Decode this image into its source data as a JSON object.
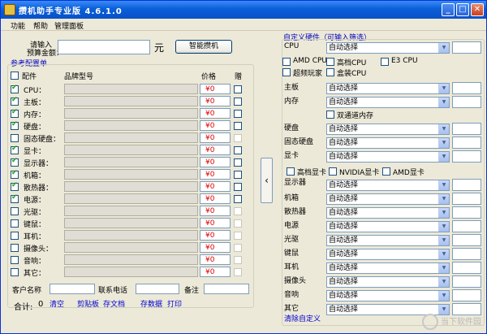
{
  "window": {
    "title": "攒机助手专业版 4.6.1.0"
  },
  "menu": [
    "功能",
    "帮助",
    "管理面板"
  ],
  "budget": {
    "label1": "请输入",
    "label2": "预算金额：",
    "value": "",
    "unit": "元",
    "button": "智能攒机"
  },
  "ref": {
    "title": "参考配置单",
    "headers": {
      "part": "配件",
      "brand": "品牌型号",
      "price": "价格",
      "gift": "赠"
    },
    "rows": [
      {
        "label": "CPU：",
        "checked": true,
        "price": "¥0",
        "gift_enabled": true
      },
      {
        "label": "主板：",
        "checked": true,
        "price": "¥0",
        "gift_enabled": true
      },
      {
        "label": "内存：",
        "checked": true,
        "price": "¥0",
        "gift_enabled": true
      },
      {
        "label": "硬盘：",
        "checked": true,
        "price": "¥0",
        "gift_enabled": true
      },
      {
        "label": "固态硬盘：",
        "checked": false,
        "price": "¥0",
        "gift_enabled": false
      },
      {
        "label": "显卡：",
        "checked": true,
        "price": "¥0",
        "gift_enabled": true
      },
      {
        "label": "显示器：",
        "checked": true,
        "price": "¥0",
        "gift_enabled": true
      },
      {
        "label": "机箱：",
        "checked": true,
        "price": "¥0",
        "gift_enabled": true
      },
      {
        "label": "散热器：",
        "checked": true,
        "price": "¥0",
        "gift_enabled": true
      },
      {
        "label": "电源：",
        "checked": true,
        "price": "¥0",
        "gift_enabled": true
      },
      {
        "label": "光驱：",
        "checked": false,
        "price": "¥0",
        "gift_enabled": false
      },
      {
        "label": "键鼠：",
        "checked": false,
        "price": "¥0",
        "gift_enabled": false
      },
      {
        "label": "耳机：",
        "checked": false,
        "price": "¥0",
        "gift_enabled": false
      },
      {
        "label": "摄像头：",
        "checked": false,
        "price": "¥0",
        "gift_enabled": false
      },
      {
        "label": "音响：",
        "checked": false,
        "price": "¥0",
        "gift_enabled": false
      },
      {
        "label": "其它：",
        "checked": false,
        "price": "¥0",
        "gift_enabled": false
      }
    ]
  },
  "customer": {
    "name_label": "客户名称",
    "phone_label": "联系电话",
    "note_label": "备注"
  },
  "total": {
    "label": "合计:",
    "value": "0"
  },
  "actions": [
    "清空",
    "剪贴板",
    "存文档",
    "存数据",
    "打印"
  ],
  "right": {
    "title": "自定义硬件（可输入筛选）",
    "select_value": "自动选择",
    "cpu_label": "CPU",
    "cpu_opts": [
      {
        "label": "AMD CPU"
      },
      {
        "label": "高档CPU"
      },
      {
        "label": "E3 CPU"
      },
      {
        "label": "超频玩家"
      },
      {
        "label": "盒装CPU"
      }
    ],
    "mb_label": "主板",
    "mem_label": "内存",
    "dual_channel": "双通道内存",
    "hdd_label": "硬盘",
    "ssd_label": "固态硬盘",
    "gpu_label": "显卡",
    "gpu_opts": [
      {
        "label": "高档显卡"
      },
      {
        "label": "NVIDIA显卡"
      },
      {
        "label": "AMD显卡"
      }
    ],
    "rows": [
      "显示器",
      "机箱",
      "散热器",
      "电源",
      "光驱",
      "键鼠",
      "耳机",
      "摄像头",
      "音响",
      "其它"
    ],
    "clear": "清除自定义"
  },
  "watermark": {
    "line1": "当下软件园",
    "line2": "www.downxia.com"
  }
}
